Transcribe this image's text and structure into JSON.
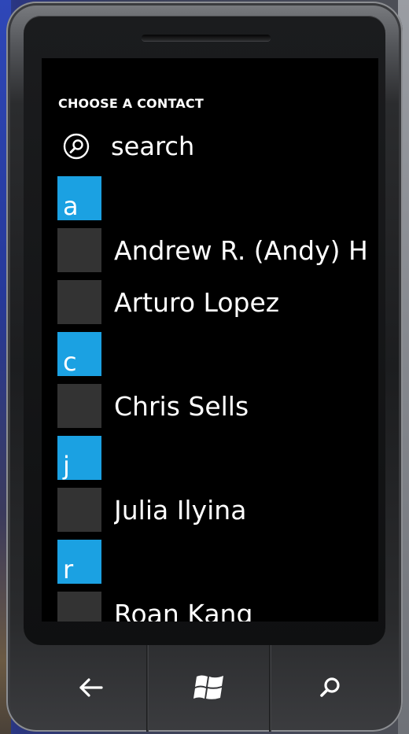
{
  "header": {
    "title": "CHOOSE A CONTACT"
  },
  "search": {
    "label": "search",
    "icon": "search-icon"
  },
  "groups": [
    {
      "letter": "a",
      "contacts": [
        "Andrew R. (Andy) H",
        "Arturo Lopez"
      ]
    },
    {
      "letter": "c",
      "contacts": [
        "Chris Sells"
      ]
    },
    {
      "letter": "j",
      "contacts": [
        "Julia Ilyina"
      ]
    },
    {
      "letter": "r",
      "contacts": [
        "Roan Kang"
      ]
    }
  ],
  "hardware_buttons": [
    {
      "icon": "back-arrow-icon"
    },
    {
      "icon": "windows-logo-icon"
    },
    {
      "icon": "search-icon"
    }
  ],
  "colors": {
    "accent": "#1ba1e2",
    "tile": "#333333",
    "background": "#000000",
    "text": "#ffffff"
  }
}
